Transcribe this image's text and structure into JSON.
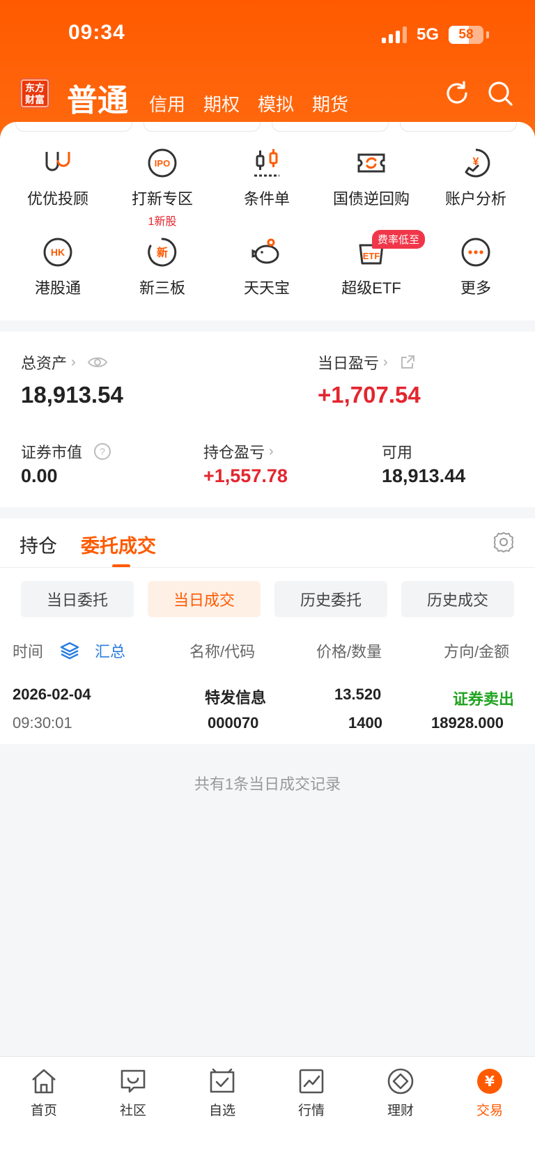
{
  "status": {
    "time": "09:34",
    "network": "5G",
    "battery": "58",
    "battery_level_percent": 58
  },
  "header": {
    "logo": "东方财富",
    "account_tabs": [
      "普通",
      "信用",
      "期权",
      "模拟",
      "期货"
    ],
    "active_tab": "普通",
    "icons": [
      "refresh-icon",
      "search-icon"
    ]
  },
  "grid": [
    {
      "label": "优优投顾",
      "icon": "advisor-icon"
    },
    {
      "label": "打新专区",
      "sub": "1新股",
      "icon": "ipo-icon"
    },
    {
      "label": "条件单",
      "icon": "candlestick-icon"
    },
    {
      "label": "国债逆回购",
      "icon": "bond-repo-icon"
    },
    {
      "label": "账户分析",
      "icon": "account-analysis-icon"
    },
    {
      "label": "港股通",
      "icon": "hk-icon"
    },
    {
      "label": "新三板",
      "icon": "new-board-icon"
    },
    {
      "label": "天天宝",
      "icon": "piggy-bank-icon"
    },
    {
      "label": "超级ETF",
      "badge": "费率低至",
      "icon": "etf-icon"
    },
    {
      "label": "更多",
      "icon": "more-icon"
    }
  ],
  "assets": {
    "total_label": "总资产",
    "total_value": "18,913.54",
    "daily_pl_label": "当日盈亏",
    "daily_pl_value": "+1,707.54",
    "market_value_label": "证券市值",
    "market_value": "0.00",
    "position_pl_label": "持仓盈亏",
    "position_pl_value": "+1,557.78",
    "available_label": "可用",
    "available_value": "18,913.44"
  },
  "orders": {
    "tabs": [
      "持仓",
      "委托成交"
    ],
    "active_tab": "委托成交",
    "filters": [
      "当日委托",
      "当日成交",
      "历史委托",
      "历史成交"
    ],
    "active_filter": "当日成交",
    "columns": {
      "time": "时间",
      "summary": "汇总",
      "name_code": "名称/代码",
      "price_qty": "价格/数量",
      "side_amount": "方向/金额"
    },
    "rows": [
      {
        "date": "2026-02-04",
        "time": "09:30:01",
        "name": "特发信息",
        "code": "000070",
        "price": "13.520",
        "qty": "1400",
        "side": "证券卖出",
        "amount": "18928.000"
      }
    ],
    "record_count_text": "共有1条当日成交记录"
  },
  "nav": [
    {
      "label": "首页",
      "icon": "home-icon"
    },
    {
      "label": "社区",
      "icon": "community-icon"
    },
    {
      "label": "自选",
      "icon": "watchlist-icon"
    },
    {
      "label": "行情",
      "icon": "market-chart-icon"
    },
    {
      "label": "理财",
      "icon": "wealth-icon"
    },
    {
      "label": "交易",
      "icon": "trade-icon"
    }
  ],
  "colors": {
    "brand": "#ff5a00",
    "rise": "#e3262f",
    "fall": "#1fa31f",
    "link": "#2a7de1"
  }
}
